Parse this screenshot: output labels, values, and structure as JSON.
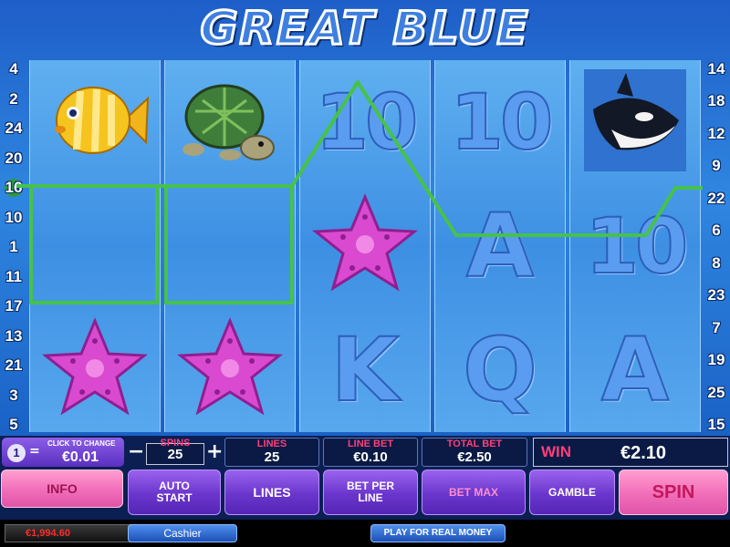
{
  "game": {
    "title": "GREAT BLUE",
    "left_line_numbers": [
      "4",
      "2",
      "24",
      "20",
      "16",
      "10",
      "1",
      "11",
      "17",
      "13",
      "21",
      "3",
      "5"
    ],
    "right_line_numbers": [
      "14",
      "18",
      "12",
      "9",
      "22",
      "6",
      "8",
      "23",
      "7",
      "19",
      "25",
      "15"
    ],
    "highlighted_line": "16",
    "reels": [
      [
        "yellow-fish",
        "",
        "starfish"
      ],
      [
        "turtle",
        "",
        "starfish"
      ],
      [
        "10",
        "starfish",
        "K"
      ],
      [
        "10",
        "A",
        "Q"
      ],
      [
        "orca",
        "10",
        "A"
      ]
    ],
    "winning_payline": {
      "line_number": "16",
      "color": "#46c24a"
    }
  },
  "controls": {
    "coin": {
      "badge": "1",
      "equals": "=",
      "caption": "CLICK TO CHANGE",
      "value": "€0.01"
    },
    "spins": {
      "label": "SPINS",
      "value": "25",
      "minus": "−",
      "plus": "+"
    },
    "lines": {
      "label": "LINES",
      "value": "25"
    },
    "line_bet": {
      "label": "LINE BET",
      "value": "€0.10"
    },
    "total_bet": {
      "label": "TOTAL BET",
      "value": "€2.50"
    },
    "win": {
      "label": "WIN",
      "value": "€2.10"
    }
  },
  "buttons": {
    "info": "INFO",
    "auto_start": "AUTO START",
    "lines": "LINES",
    "bet_per_line": "BET PER LINE",
    "bet_max": "BET MAX",
    "gamble": "GAMBLE",
    "spin": "SPIN"
  },
  "footer": {
    "balance": "€1,994.60",
    "cashier": "Cashier",
    "play_real": "PLAY FOR REAL MONEY"
  },
  "colors": {
    "accent_pink": "#ff3f7a",
    "button_purple": "#6a35cc",
    "payline_green": "#46c24a"
  }
}
